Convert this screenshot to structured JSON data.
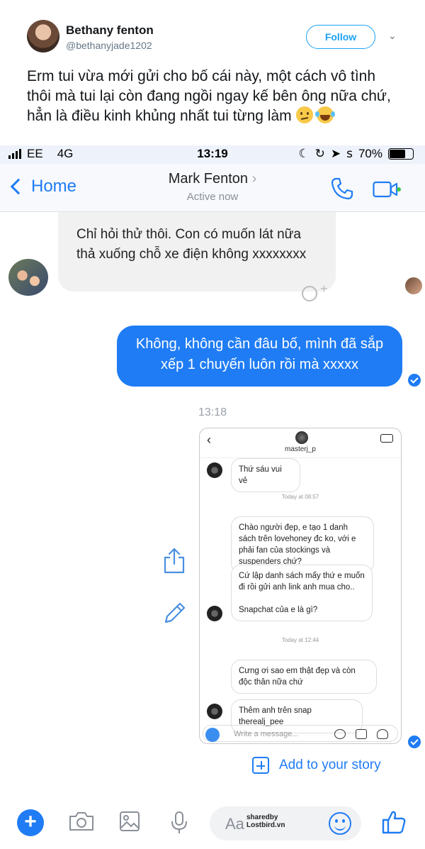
{
  "tweet": {
    "name": "Bethany fenton",
    "handle": "@bethanyjade1202",
    "follow_label": "Follow",
    "text": "Erm tui vừa mới gửi cho bố cái này, một cách vô tình thôi mà tui lại còn đang ngồi ngay kế bên ông nữa chứ, hẳn là điều kinh khủng nhất tui từng làm"
  },
  "status_bar": {
    "carrier": "EE",
    "network": "4G",
    "time": "13:19",
    "battery": "70%",
    "battery_level": 0.7
  },
  "nav": {
    "back_label": "Home",
    "contact_name": "Mark Fenton",
    "contact_status": "Active now"
  },
  "messages": {
    "incoming_1": "Chỉ hỏi thử thôi. Con có muốn lát nữa thả xuống chỗ xe điện không xxxxxxxx",
    "outgoing_1": "Không, không cần đâu bố, mình đã sắp xếp 1 chuyến luôn rồi mà xxxxx",
    "timestamp": "13:18"
  },
  "embedded_dm": {
    "username": "masterj_p",
    "msg_1": "Thứ sáu vui vẻ",
    "stamp_1": "Today at 08:57",
    "msg_2": "Chào người đẹp, e tạo 1 danh sách trên lovehoney đc ko, với e phải fan của stockings và suspenders chứ?",
    "msg_3": "Cứ lập danh sách mấy thứ e muốn đi rồi gửi anh link anh mua cho..",
    "msg_3b": "Snapchat của e là gì?",
    "stamp_2": "Today at 12:44",
    "msg_4": "Cưng ơi sao em thật đẹp và còn độc thân nữa chứ",
    "msg_5": "Thêm anh trên snap therealj_pee",
    "input_placeholder": "Write a message..."
  },
  "story_label": "Add to your story",
  "composer": {
    "placeholder": "Aa",
    "watermark_1": "sharedby",
    "watermark_2": "Lostbird.vn"
  },
  "colors": {
    "messenger_blue": "#1f7cf4",
    "twitter_blue": "#1da1f2"
  }
}
